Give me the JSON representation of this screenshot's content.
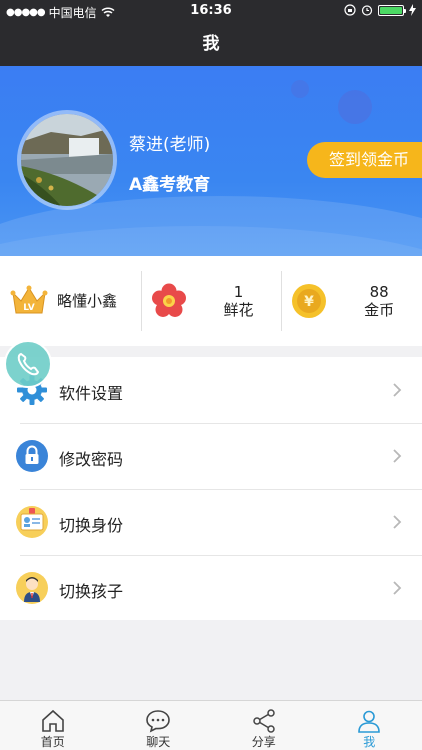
{
  "status_bar": {
    "carrier": "中国电信",
    "time": "16:36"
  },
  "nav": {
    "title": "我"
  },
  "profile": {
    "name": "蔡进(老师)",
    "org": "A鑫考教育",
    "signin_label": "签到领金币"
  },
  "stats": [
    {
      "label": "略懂小鑫",
      "icon": "crown-icon"
    },
    {
      "value": "1",
      "label": "鲜花",
      "icon": "flower-icon"
    },
    {
      "value": "88",
      "label": "金币",
      "icon": "coin-icon"
    }
  ],
  "menu": [
    {
      "label": "软件设置",
      "icon": "gear-icon"
    },
    {
      "label": "修改密码",
      "icon": "lock-icon"
    },
    {
      "label": "切换身份",
      "icon": "id-card-icon"
    },
    {
      "label": "切换孩子",
      "icon": "child-icon"
    }
  ],
  "tabs": [
    {
      "label": "首页",
      "icon": "home-icon"
    },
    {
      "label": "聊天",
      "icon": "chat-icon"
    },
    {
      "label": "分享",
      "icon": "share-icon"
    },
    {
      "label": "我",
      "icon": "person-icon",
      "active": true
    }
  ],
  "colors": {
    "header_bg": "#2b2b2e",
    "profile_blue": "#3b7df3",
    "signin_orange": "#f6b61b",
    "tab_active": "#2a9ad6"
  }
}
